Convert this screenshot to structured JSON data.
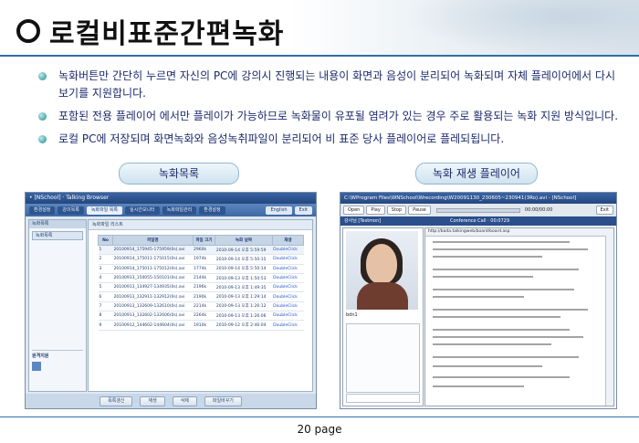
{
  "header": {
    "title": "로컬비표준간편녹화"
  },
  "bullets": [
    "녹화버튼만 간단히 누르면 자신의 PC에 강의시 진행되는 내용이 화면과 음성이 분리되어 녹화되며 자체 플레이어에서 다시보기를 지원합니다.",
    "포함된 전용 플레이어 에서만 플레이가 가능하므로 녹화물이 유포될 염려가 있는 경우 주로 활용되는 녹화 지원 방식입니다.",
    "로컬 PC에 저장되며 화면녹화와 음성녹취파일이 분리되어 비 표준 당사 플레이어로 플레되됩니다."
  ],
  "labels": {
    "left": "녹화목록",
    "right": "녹화 재생 플레이어"
  },
  "screenshot1": {
    "titlebar": "• [NSchool] · Talking Browser",
    "tabs": [
      "환경설정",
      "강의목록",
      "녹화파일 목록",
      "실시간모니터",
      "녹화파일관리",
      "환경설정"
    ],
    "active_tab": 2,
    "right_buttons": [
      "English",
      "Exit"
    ],
    "side_header": "녹화목록",
    "side_item": "녹화목록",
    "guide_title": "원격지원",
    "main_header": "녹화파일 리스트",
    "columns": [
      "No",
      "파일명",
      "파일 크기",
      "녹화 날짜",
      "재생"
    ],
    "rows": [
      [
        "1",
        "20100914_175945-175959(0s).avi",
        "2960k",
        "2010-09-14 오후 5:59:59",
        "DoubleClick"
      ],
      [
        "2",
        "20100914_175011-175015(0s).avi",
        "1974k",
        "2010-09-14 오후 5:50:15",
        "DoubleClick"
      ],
      [
        "3",
        "20100914_175011-175012(0s).avi",
        "1774k",
        "2010-09-14 오후 5:50:14",
        "DoubleClick"
      ],
      [
        "4",
        "20100913_150055-150101(0s).avi",
        "2144k",
        "2010-09-13 오후 1:50:53",
        "DoubleClick"
      ],
      [
        "5",
        "20100913_134927-134935(0s).avi",
        "2196k",
        "2010-09-13 오후 1:49:35",
        "DoubleClick"
      ],
      [
        "6",
        "20100913_132911-132912(0s).avi",
        "2190k",
        "2010-09-13 오후 1:29:14",
        "DoubleClick"
      ],
      [
        "7",
        "20100913_132609-132610(0s).avi",
        "2214k",
        "2010-09-13 오후 1:26:12",
        "DoubleClick"
      ],
      [
        "8",
        "20100913_132602-132606(0s).avi",
        "2264k",
        "2010-09-13 오후 1:26:06",
        "DoubleClick"
      ],
      [
        "9",
        "20100912_144602-144604(0s).avi",
        "1910k",
        "2010-09-12 오후 2:46:04",
        "DoubleClick"
      ]
    ],
    "bottom_buttons": [
      "목록갱신",
      "재생",
      "삭제",
      "파일바꾸기"
    ]
  },
  "screenshot2": {
    "titlebar": "C:\\WProgram Files\\WNSchool\\Wrecording\\W20091130_230605~230941(3Ro).avi - [NSchool]",
    "controls": [
      "Open",
      "Play",
      "Stop",
      "Pause"
    ],
    "time": "00:00/00:00",
    "exit": "Exit",
    "conf_left": "강사님 [Testmon]",
    "conf_title": "Conference Call · 00:0729",
    "username": "bdn1",
    "url": "http://bada.talkingweb/board/board.asp"
  },
  "footer": {
    "page": "20 page"
  }
}
